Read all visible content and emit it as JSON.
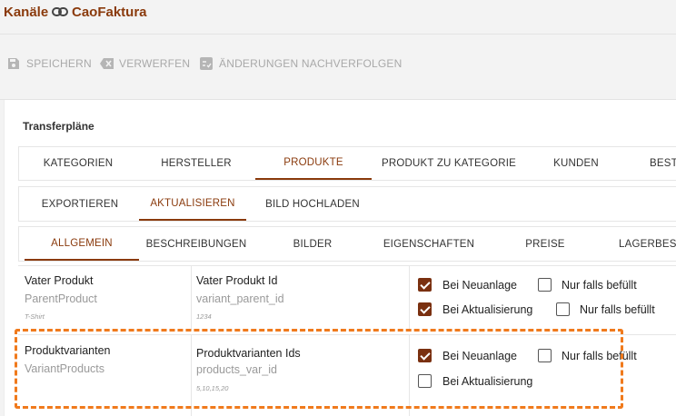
{
  "breadcrumb": {
    "root": "Kanäle",
    "link_icon": "link-icon",
    "current": "CaoFaktura"
  },
  "toolbar": {
    "save": {
      "label": "SPEICHERN",
      "icon": "save-icon"
    },
    "discard": {
      "label": "VERWERFEN",
      "icon": "discard-icon"
    },
    "track": {
      "label": "ÄNDERUNGEN NACHVERFOLGEN",
      "icon": "track-changes-icon"
    }
  },
  "section_title": "Transferpläne",
  "main_tabs": [
    "KATEGORIEN",
    "HERSTELLER",
    "PRODUKTE",
    "PRODUKT ZU KATEGORIE",
    "KUNDEN",
    "BEST"
  ],
  "main_tabs_active": "PRODUKTE",
  "action_tabs": [
    "EXPORTIEREN",
    "AKTUALISIEREN",
    "BILD HOCHLADEN"
  ],
  "action_tabs_active": "AKTUALISIEREN",
  "sub_tabs": [
    "ALLGEMEIN",
    "BESCHREIBUNGEN",
    "BILDER",
    "EIGENSCHAFTEN",
    "PREISE",
    "LAGERBEST"
  ],
  "sub_tabs_active": "ALLGEMEIN",
  "rows": [
    {
      "label": "Vater Produkt",
      "key": "ParentProduct",
      "example": "T-Shirt",
      "target_label": "Vater Produkt Id",
      "target_key": "variant_parent_id",
      "target_example": "1234",
      "on_create": {
        "label": "Bei Neuanlage",
        "checked": true
      },
      "on_create_only_filled": {
        "label": "Nur falls befüllt",
        "checked": false
      },
      "on_update": {
        "label": "Bei Aktualisierung",
        "checked": true
      },
      "on_update_only_filled": {
        "label": "Nur falls befüllt",
        "checked": false
      }
    },
    {
      "label": "Produktvarianten",
      "key": "VariantProducts",
      "example": "",
      "target_label": "Produktvarianten Ids",
      "target_key": "products_var_id",
      "target_example": "5,10,15,20",
      "on_create": {
        "label": "Bei Neuanlage",
        "checked": true
      },
      "on_create_only_filled": {
        "label": "Nur falls befüllt",
        "checked": false
      },
      "on_update": {
        "label": "Bei Aktualisierung",
        "checked": false
      }
    }
  ],
  "colors": {
    "accent": "#8a3a0c",
    "highlight": "#f07a1c",
    "muted": "#a9a9a9"
  }
}
